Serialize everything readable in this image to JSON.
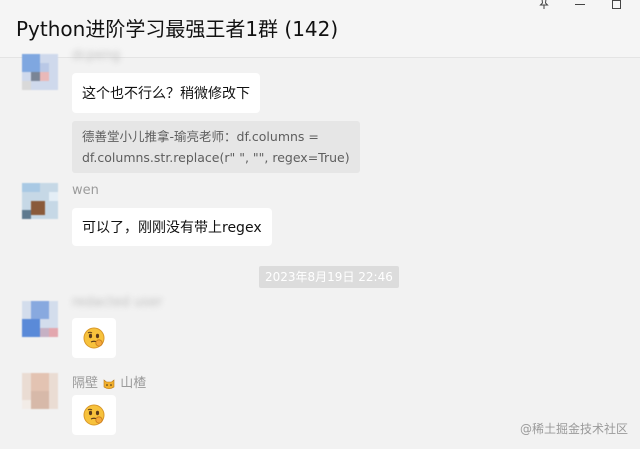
{
  "window": {
    "title": "Python进阶学习最强王者1群 (142)"
  },
  "messages": [
    {
      "sender": "dcpeng",
      "text": "这个也不行么？稍微修改下",
      "quote_line1": "德善堂小儿推拿-瑜亮老师：df.columns =",
      "quote_line2": "df.columns.str.replace(r\" \", \"\", regex=True)"
    },
    {
      "sender": "wen",
      "text": "可以了，刚刚没有带上regex"
    },
    {
      "timestamp": "2023年8月19日 22:46"
    },
    {
      "sender": "redacted user",
      "sticker": "thinking-face-sticker"
    },
    {
      "sender_prefix": "隔壁",
      "sender_suffix": "山楂",
      "sticker": "thinking-face-sticker"
    }
  ],
  "watermark": "@稀土掘金技术社区",
  "colors": {
    "background": "#f2f2f2",
    "bubble": "#ffffff",
    "quote": "#e6e6e6",
    "timestamp_bg": "#dcdcdc",
    "sender_text": "#9b9b9b"
  }
}
